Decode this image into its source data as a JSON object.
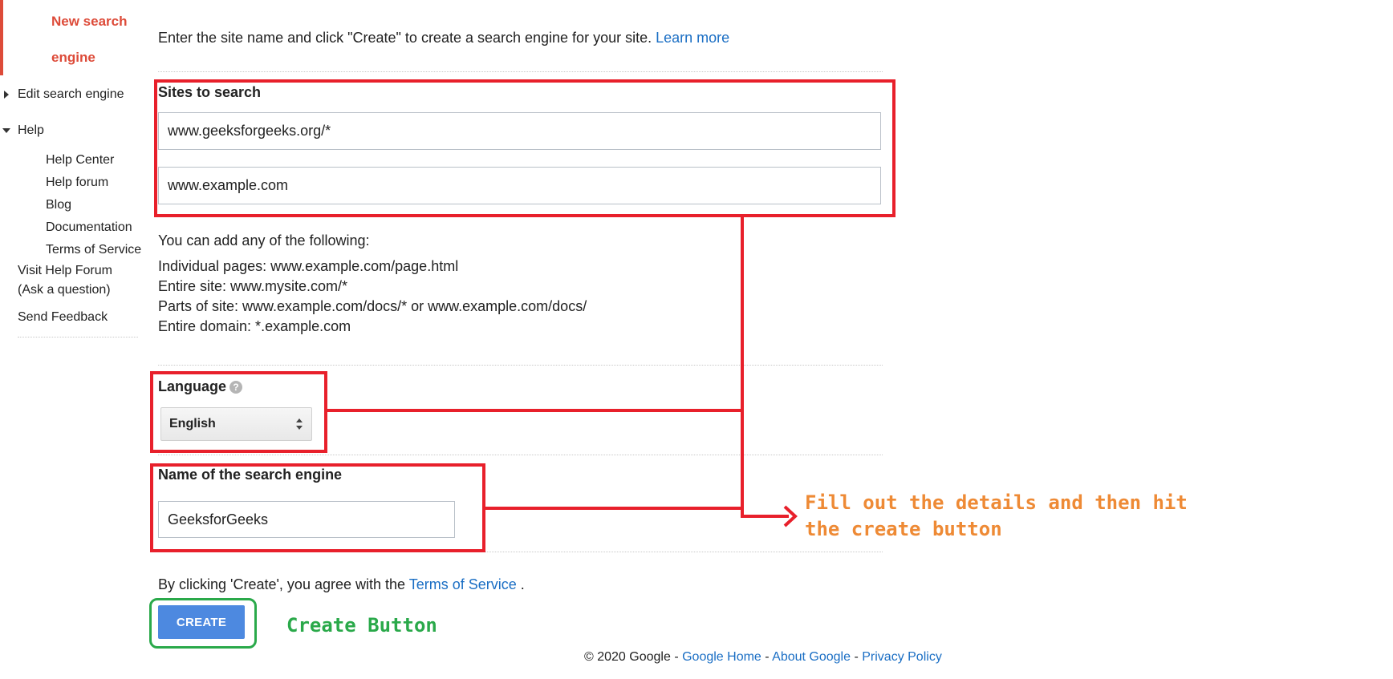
{
  "sidebar": {
    "active_item_line1": "New search",
    "active_item_line2": "engine",
    "edit_item": "Edit search engine",
    "help_section": "Help",
    "help_links": [
      "Help Center",
      "Help forum",
      "Blog",
      "Documentation",
      "Terms of Service"
    ],
    "visit_forum_line1": "Visit Help Forum",
    "visit_forum_line2": "(Ask a question)",
    "send_feedback": "Send Feedback"
  },
  "main": {
    "intro_text": "Enter the site name and click \"Create\" to create a search engine for your site.",
    "learn_more": "Learn more",
    "sites_label": "Sites to search",
    "site_input_1": "www.geeksforgeeks.org/*",
    "site_input_2": "www.example.com",
    "add_hint": "You can add any of the following:",
    "examples": [
      "Individual pages: www.example.com/page.html",
      "Entire site: www.mysite.com/*",
      "Parts of site: www.example.com/docs/* or www.example.com/docs/",
      "Entire domain: *.example.com"
    ],
    "language_label": "Language",
    "language_help_icon": "?",
    "language_value": "English",
    "name_label": "Name of the search engine",
    "name_value": "GeeksforGeeks",
    "terms_prefix": "By clicking 'Create', you agree with the",
    "terms_link": "Terms of Service",
    "terms_suffix": ".",
    "create_button": "CREATE"
  },
  "annotations": {
    "callout_line1": "Fill out the details and then hit",
    "callout_line2": "the create button",
    "create_callout": "Create Button"
  },
  "footer": {
    "copyright": "© 2020 Google",
    "sep1": " - ",
    "home": "Google Home",
    "sep2": " - ",
    "about": "About Google",
    "sep3": " - ",
    "privacy": "Privacy Policy"
  },
  "colors": {
    "accent_red": "#dd4b39",
    "annotation_red": "#e8202b",
    "annotation_green": "#2aa94a",
    "annotation_orange": "#ee8a35",
    "link_blue": "#1a6ec4",
    "button_blue": "#4d89e0"
  }
}
